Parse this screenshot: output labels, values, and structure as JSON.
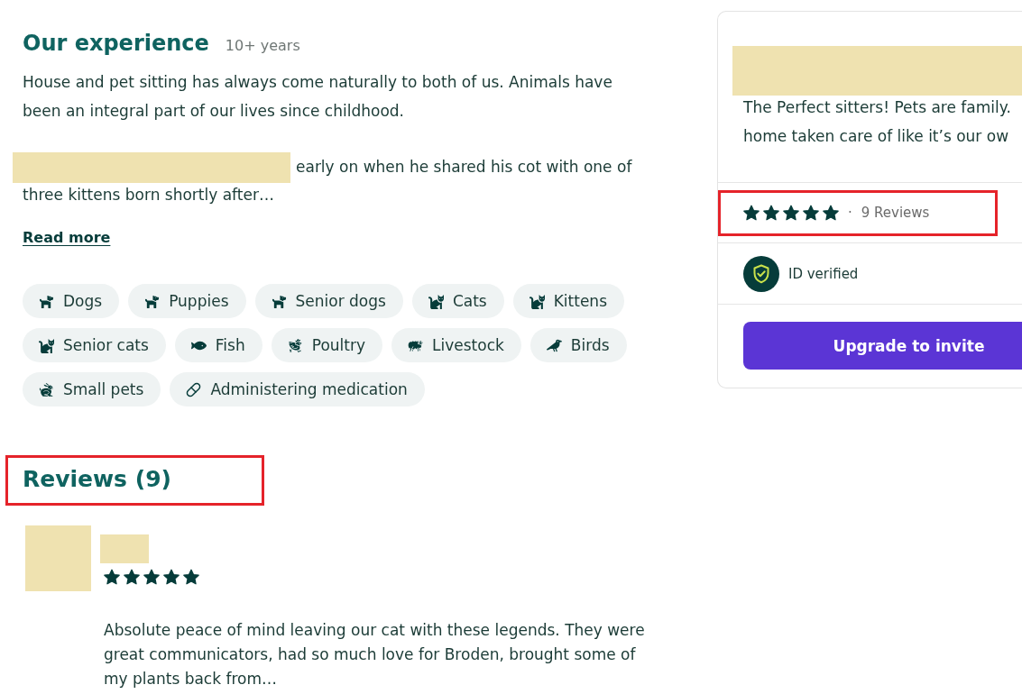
{
  "experience": {
    "title": "Our experience",
    "years": "10+ years",
    "paragraphs": [
      {
        "text": "House and pet sitting has always come naturally to both of us. Animals have been an integral part of our lives since childhood.",
        "redacted_start": false
      },
      {
        "text": "early on when he shared his cot with one of three kittens born shortly after…",
        "redacted_start": true
      }
    ],
    "read_more": "Read more"
  },
  "services": [
    {
      "label": "Dogs",
      "kind": "dog"
    },
    {
      "label": "Puppies",
      "kind": "dog"
    },
    {
      "label": "Senior dogs",
      "kind": "dog"
    },
    {
      "label": "Cats",
      "kind": "cat"
    },
    {
      "label": "Kittens",
      "kind": "cat"
    },
    {
      "label": "Senior cats",
      "kind": "cat"
    },
    {
      "label": "Fish",
      "kind": "fish"
    },
    {
      "label": "Poultry",
      "kind": "poultry"
    },
    {
      "label": "Livestock",
      "kind": "livestock"
    },
    {
      "label": "Birds",
      "kind": "bird"
    },
    {
      "label": "Small pets",
      "kind": "small_pet"
    },
    {
      "label": "Administering medication",
      "kind": "medication"
    }
  ],
  "reviews": {
    "title": "Reviews (9)",
    "highlighted": true,
    "items": [
      {
        "stars": 5,
        "text": "Absolute peace of mind leaving our cat with these legends. They were great communicators, had so much love for Broden, brought some of my plants back from…"
      }
    ]
  },
  "profile_card": {
    "intro": "The Perfect sitters! Pets are family.\nhome taken care of like it’s our ow",
    "rating": {
      "stars": 5,
      "separator": "·",
      "count": "9 Reviews",
      "highlighted": true
    },
    "verification": {
      "label": "ID verified"
    },
    "button": "Upgrade to invite"
  }
}
